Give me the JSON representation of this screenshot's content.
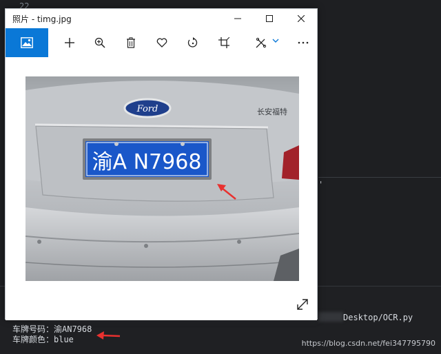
{
  "background": {
    "line_number": "22",
    "quote_char": "'",
    "terminal": {
      "path_text": "Desktop/OCR.py",
      "plate_line": "车牌号码：渝AN7968",
      "color_line": "车牌颜色：blue"
    },
    "watermark": "https://blog.csdn.net/fei347795790"
  },
  "window": {
    "title": "照片 - timg.jpg",
    "controls": {
      "minimize_icon": "minimize-icon",
      "maximize_icon": "maximize-icon",
      "close_icon": "close-icon"
    }
  },
  "toolbar": {
    "items": [
      {
        "name": "view-photo",
        "icon": "image-icon",
        "active": true
      },
      {
        "name": "add",
        "icon": "plus-icon"
      },
      {
        "name": "zoom",
        "icon": "zoom-in-icon"
      },
      {
        "name": "delete",
        "icon": "trash-icon"
      },
      {
        "name": "favorite",
        "icon": "heart-icon"
      },
      {
        "name": "rotate",
        "icon": "rotate-icon"
      },
      {
        "name": "crop",
        "icon": "crop-icon"
      },
      {
        "name": "edit",
        "icon": "edit-icon"
      },
      {
        "name": "more",
        "icon": "more-icon"
      }
    ],
    "accent_color": "#0a78d7"
  },
  "photo": {
    "plate_text": "渝A N7968",
    "brand_badge": "Ford",
    "car_text": "长安福特",
    "plate_color": "#1a57c9",
    "car_color": "#c9cccf",
    "annotation_arrow_color": "#e8312f"
  }
}
